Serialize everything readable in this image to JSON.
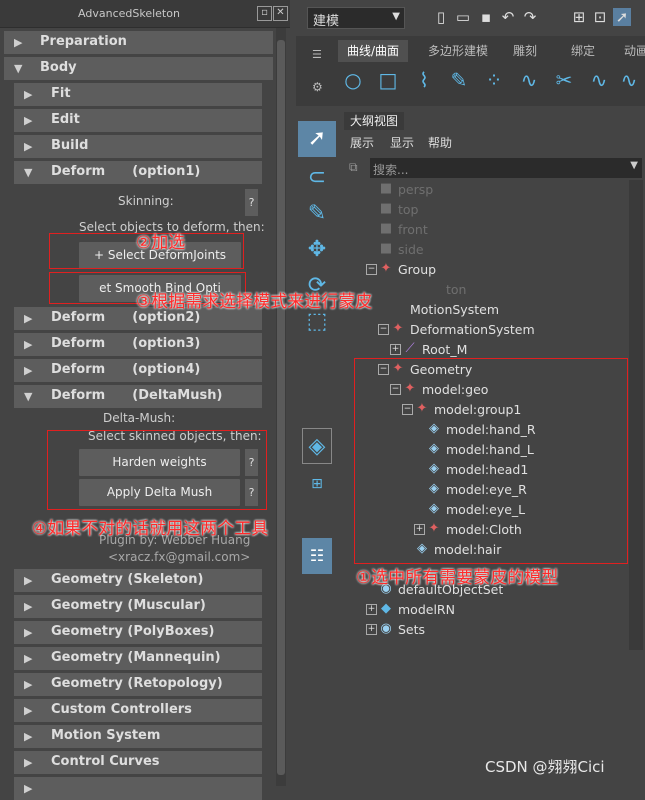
{
  "panel": {
    "title": "AdvancedSkeleton",
    "sections": {
      "preparation": "Preparation",
      "body": "Body",
      "fit": "Fit",
      "edit": "Edit",
      "build": "Build",
      "deform1": "Deform      (option1)",
      "skinning": "Skinning:",
      "select_obj": "Select objects to deform, then:",
      "select_deform_joints": "+ Select DeformJoints",
      "smooth_bind": "et Smooth Bind Opti",
      "deform2": "Deform      (option2)",
      "deform3": "Deform      (option3)",
      "deform4": "Deform      (option4)",
      "deform_dm": "Deform      (DeltaMush)",
      "delta_mush": "Delta-Mush:",
      "select_skinned": "Select skinned objects, then:",
      "harden_weights": "Harden weights",
      "apply_delta_mush": "Apply Delta Mush",
      "q": "?",
      "plugin_by": "Plugin by: Webber Huang",
      "plugin_email": "<xracz.fx@gmail.com>",
      "geo_skeleton": "Geometry (Skeleton)",
      "geo_muscular": "Geometry (Muscular)",
      "geo_polyboxes": "Geometry (PolyBoxes)",
      "geo_mannequin": "Geometry (Mannequin)",
      "geo_retopology": "Geometry (Retopology)",
      "custom_controllers": "Custom Controllers",
      "motion_system": "Motion System",
      "control_curves": "Control Curves"
    }
  },
  "annotations": {
    "a1": "①选中所有需要蒙皮的模型",
    "a2": "②加选",
    "a3": "③根据需求选择模式来进行蒙皮",
    "a4": "④如果不对的话就用这两个工具"
  },
  "toolbar": {
    "mode": "建模",
    "shelf_tabs": [
      "曲线/曲面",
      "多边形建模",
      "雕刻",
      "绑定",
      "动画"
    ]
  },
  "outliner": {
    "tab": "大纲视图",
    "menu": [
      "展示",
      "显示",
      "帮助"
    ],
    "search_placeholder": "搜索...",
    "items": {
      "persp": "persp",
      "top": "top",
      "front": "front",
      "side": "side",
      "group": "Group",
      "skeleton_hidden": "ton",
      "motion_system": "MotionSystem",
      "deformation_system": "DeformationSystem",
      "root_m": "Root_M",
      "geometry": "Geometry",
      "model_geo": "model:geo",
      "model_group1": "model:group1",
      "hand_r": "model:hand_R",
      "hand_l": "model:hand_L",
      "head1": "model:head1",
      "eye_r": "model:eye_R",
      "eye_l": "model:eye_L",
      "cloth": "model:Cloth",
      "hair": "model:hair",
      "default_object_set": "defaultObjectSet",
      "model_rn": "modelRN",
      "sets": "Sets"
    }
  },
  "watermark": "CSDN @翙翙Cici",
  "colors": {
    "annotation": "#ff2a2a",
    "accent": "#5fb8e6"
  }
}
